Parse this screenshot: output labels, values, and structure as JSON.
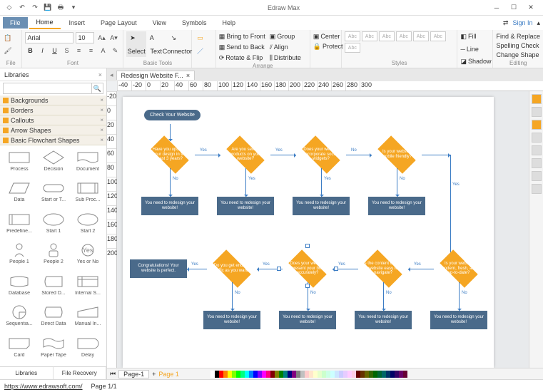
{
  "app": {
    "title": "Edraw Max"
  },
  "qat": [
    "undo-icon",
    "redo-icon",
    "save-icon",
    "print-icon"
  ],
  "win": {
    "signin": "Sign In"
  },
  "menu": {
    "file": "File",
    "home": "Home",
    "insert": "Insert",
    "pagelayout": "Page Layout",
    "view": "View",
    "symbols": "Symbols",
    "help": "Help"
  },
  "ribbon": {
    "font": {
      "name": "Arial",
      "size": "10",
      "label": "Font"
    },
    "file": {
      "label": "File"
    },
    "basic": {
      "select": "Select",
      "text": "Text",
      "connector": "Connector",
      "label": "Basic Tools"
    },
    "arrange": {
      "bringfront": "Bring to Front",
      "sendback": "Send to Back",
      "rotate": "Rotate & Flip",
      "group": "Group",
      "align": "Align",
      "center": "Center",
      "distribute": "Distribute",
      "protect": "Protect",
      "label": "Arrange"
    },
    "styles": {
      "label": "Styles"
    },
    "line": {
      "fill": "Fill",
      "line": "Line",
      "shadow": "Shadow",
      "label": ""
    },
    "editing": {
      "find": "Find & Replace",
      "spell": "Spelling Check",
      "change": "Change Shape",
      "label": "Editing"
    }
  },
  "libraries": {
    "title": "Libraries",
    "cats": [
      "Backgrounds",
      "Borders",
      "Callouts",
      "Arrow Shapes",
      "Basic Flowchart Shapes"
    ],
    "shapes": [
      {
        "n": "Process"
      },
      {
        "n": "Decision"
      },
      {
        "n": "Document"
      },
      {
        "n": "Data"
      },
      {
        "n": "Start or T..."
      },
      {
        "n": "Sub Proc..."
      },
      {
        "n": "Predefine..."
      },
      {
        "n": "Start 1"
      },
      {
        "n": "Start 2"
      },
      {
        "n": "People 1"
      },
      {
        "n": "People 2"
      },
      {
        "n": "Yes or No"
      },
      {
        "n": "Database"
      },
      {
        "n": "Stored D..."
      },
      {
        "n": "Internal S..."
      },
      {
        "n": "Sequentia..."
      },
      {
        "n": "Direct Data"
      },
      {
        "n": "Manual In..."
      },
      {
        "n": "Card"
      },
      {
        "n": "Paper Tape"
      },
      {
        "n": "Delay"
      }
    ],
    "tabs": {
      "lib": "Libraries",
      "rec": "File Recovery"
    }
  },
  "doc": {
    "tab": "Redesign Website F...",
    "page": "Page-1",
    "page1": "Page 1"
  },
  "status": {
    "url": "https://www.edrawsoft.com/",
    "page": "Page 1/1"
  },
  "flow": {
    "start": "Check Your Website",
    "d1": "Have you updated your design in the past 3 years?",
    "d2": "Are you selling products on your website?",
    "d3": "Does your website incorporate social widgets?",
    "d4": "Is your website mobile friendly?",
    "d5": "Do you get enough traffic as you want?",
    "d6": "Does your website represent your brand accurately?",
    "d7": "Is the content of your website easy to navigate?",
    "d8": "Is your website modern, fresh, and up-to-date?",
    "box": "You need to redesign your website!",
    "congrats": "Congratulations! Your website is perfect.",
    "yes": "Yes",
    "no": "No"
  },
  "ruler": [
    "-40",
    "-20",
    "0",
    "20",
    "40",
    "60",
    "80",
    "100",
    "120",
    "140",
    "160",
    "180",
    "200",
    "220",
    "240",
    "260",
    "280",
    "300"
  ],
  "vruler": [
    "-20",
    "0",
    "20",
    "40",
    "60",
    "80",
    "100",
    "120",
    "140",
    "160",
    "180",
    "200"
  ],
  "colors": [
    "#ffffff",
    "#000000",
    "#ff0000",
    "#ff8000",
    "#ffff00",
    "#80ff00",
    "#00ff00",
    "#00ff80",
    "#00ffff",
    "#0080ff",
    "#0000ff",
    "#8000ff",
    "#ff00ff",
    "#ff0080",
    "#800000",
    "#808000",
    "#008000",
    "#008080",
    "#000080",
    "#800080",
    "#808080",
    "#c0c0c0",
    "#ffcccc",
    "#ffe6cc",
    "#ffffcc",
    "#e6ffcc",
    "#ccffcc",
    "#ccffe6",
    "#ccffff",
    "#cce6ff",
    "#ccccff",
    "#e6ccff",
    "#ffccff",
    "#ffcce6",
    "#660000",
    "#663300",
    "#666600",
    "#336600",
    "#006600",
    "#006633",
    "#006666",
    "#003366",
    "#000066",
    "#330066",
    "#660066",
    "#660033"
  ]
}
